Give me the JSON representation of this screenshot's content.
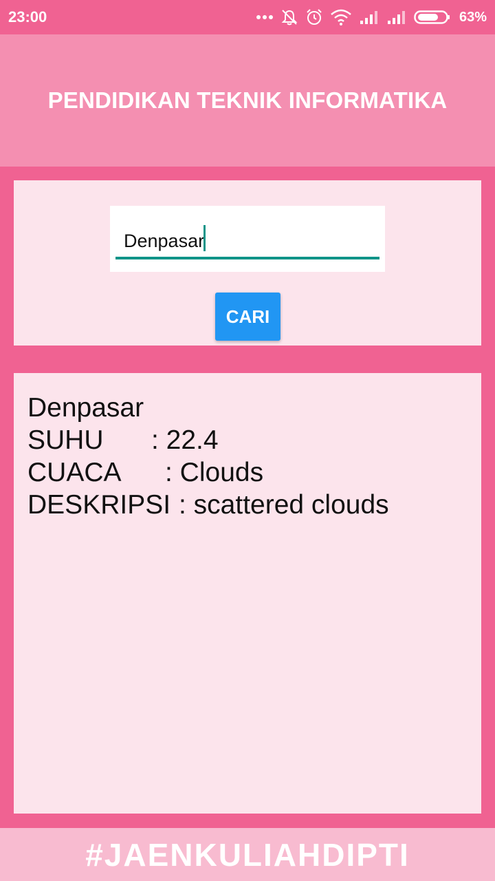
{
  "status_bar": {
    "time": "23:00",
    "icons": [
      "more-dots-icon",
      "notifications-off-icon",
      "alarm-icon",
      "wifi-icon",
      "signal-icon",
      "signal-icon",
      "battery-icon"
    ],
    "battery": "63%"
  },
  "header": {
    "title": "PENDIDIKAN TEKNIK INFORMATIKA"
  },
  "search": {
    "value": "Denpasar",
    "button_label": "CARI"
  },
  "result": {
    "city": "Denpasar",
    "rows": [
      {
        "label": "SUHU",
        "value": ": 22.4"
      },
      {
        "label": "CUACA",
        "value": ": Clouds"
      },
      {
        "label": "DESKRIPSI",
        "value": ": scattered clouds"
      }
    ]
  },
  "footer": {
    "text": "#JAENKULIAHDIPTI"
  },
  "colors": {
    "background": "#f06292",
    "header": "#f48fb1",
    "panel": "#fce4ec",
    "footer": "#f8bbd0",
    "button": "#2196f3",
    "input_underline": "#0d9488"
  }
}
